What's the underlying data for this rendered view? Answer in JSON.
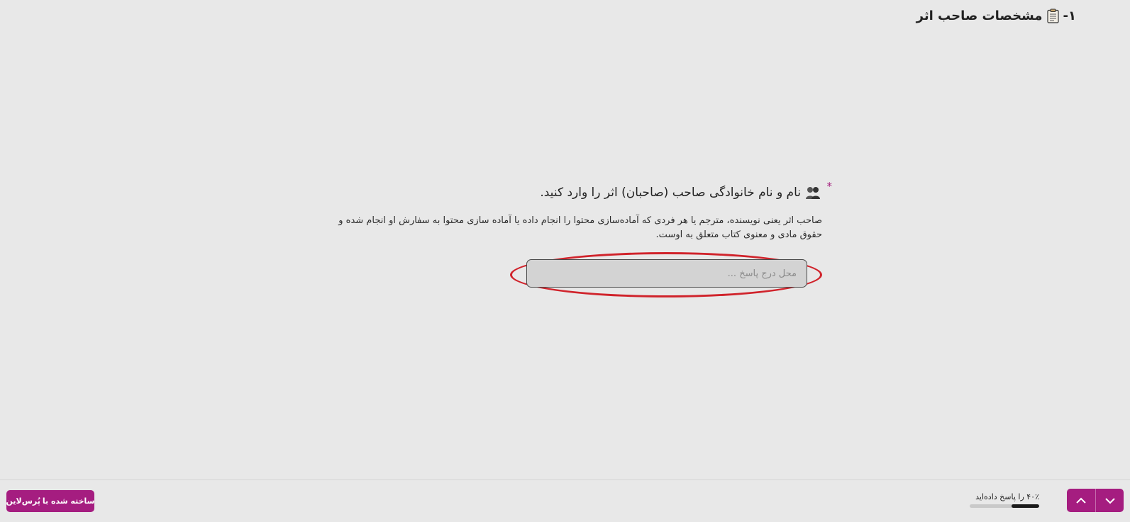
{
  "section": {
    "number": "۱-",
    "title": "مشخصات صاحب اثر",
    "icon": "clipboard-icon"
  },
  "question": {
    "required_mark": "*",
    "icon": "people-icon",
    "title": "نام و نام خانوادگی صاحب (صاحبان) اثر را وارد کنید.",
    "description": "صاحب اثر یعنی نویسنده، مترجم یا هر فردی که آماده‌سازی محتوا را انجام داده یا آماده سازی محتوا به سفارش او انجام شده و حقوق مادی و معنوی کتاب متعلق به اوست.",
    "answer_value": "",
    "answer_placeholder": "محل درج پاسخ ..."
  },
  "footer": {
    "progress_label": "۴۰٪ را پاسخ داده‌اید",
    "progress_fraction": 0.4,
    "brand_prefix": "ساخته شده با",
    "brand_name": "پُرس‌لاین",
    "nav_up_icon": "chevron-up-icon",
    "nav_down_icon": "chevron-down-icon"
  },
  "colors": {
    "accent": "#a51d80",
    "highlight": "#d0232b",
    "background": "#e8e8e8",
    "input_bg": "#d3d3d3"
  }
}
